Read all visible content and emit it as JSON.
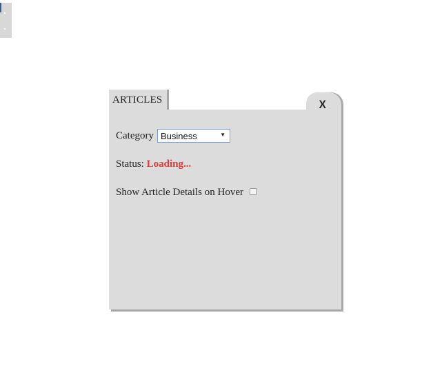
{
  "widget": {
    "tab_label": "ARTICLES",
    "close_label": "X"
  },
  "form": {
    "category_label": "Category",
    "category_selected": "Business",
    "status_label": "Status:",
    "status_value": "Loading...",
    "hover_label": "Show Article Details on Hover",
    "hover_checked": false
  },
  "icons": {
    "dropdown": "chevron-down-icon",
    "close": "close-icon"
  },
  "colors": {
    "panel_bg": "#dcdcdc",
    "panel_shadow": "#a8a8a8",
    "status_value": "#e03b3b",
    "select_border": "#7a9cd3"
  }
}
